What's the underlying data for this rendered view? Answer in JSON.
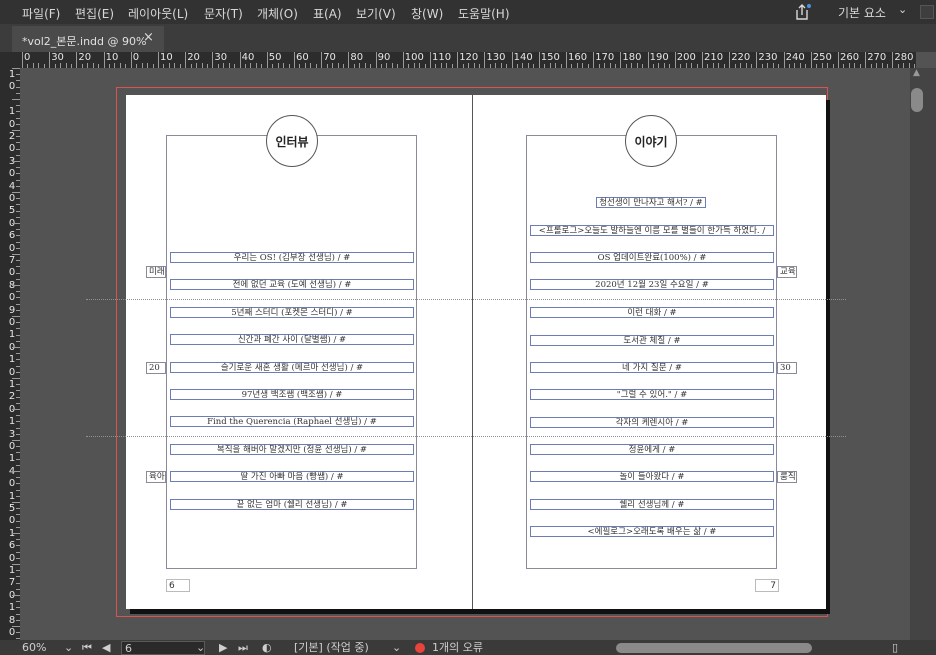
{
  "menubar": {
    "items": [
      "파일(F)",
      "편집(E)",
      "레이아웃(L)",
      "문자(T)",
      "개체(O)",
      "표(A)",
      "보기(V)",
      "창(W)",
      "도움말(H)"
    ],
    "workspace": "기본 요소",
    "workspace_caret": "⌄",
    "share_icon": "share-icon"
  },
  "tab": {
    "label": "*vol2_본문.indd @ 90%",
    "close": "×"
  },
  "ruler": {
    "h_labels": [
      "0",
      "30",
      "20",
      "10",
      "0",
      "10",
      "20",
      "30",
      "40",
      "50",
      "60",
      "70",
      "80",
      "90",
      "100",
      "110",
      "120",
      "130",
      "140",
      "150",
      "160",
      "170",
      "180",
      "190",
      "200",
      "210",
      "220",
      "230",
      "240",
      "250",
      "260",
      "270",
      "280"
    ],
    "v_labels": [
      "1",
      "0",
      "",
      "1",
      "0",
      "2",
      "0",
      "3",
      "0",
      "4",
      "0",
      "5",
      "0",
      "6",
      "0",
      "7",
      "0",
      "8",
      "0",
      "9",
      "0",
      "1",
      "0",
      "1",
      "0",
      "1",
      "2",
      "0",
      "1",
      "3",
      "0",
      "1",
      "4",
      "0",
      "1",
      "5",
      "0",
      "1",
      "6",
      "0",
      "1",
      "7",
      "0",
      "1",
      "8",
      "0"
    ]
  },
  "left_page": {
    "heading": "인터뷰",
    "items": [
      "우리는 OS! (김부장 선생님) / #",
      "전에 없던 교육 (도예 선생님) / #",
      "5년째 스터디 (포켓몬 스터디) / #",
      "신간과 폐간 사이 (달별쌤) / #",
      "슬기로운 새혼 생활 (메르마 선생님) / #",
      "97년생 백조쌤 (백조쌤) / #",
      "Find the Querencia (Raphael 선생님) / #",
      "복직을 해버아 말겠지만 (정윤 선생님) / #",
      "딸 가진 아빠 마음 (빵쌤) / #",
      "끝 없는 엄마 (쉘리 선생님) / #"
    ],
    "side_tags": [
      "미래",
      "20",
      "육아"
    ],
    "folio": "6"
  },
  "right_page": {
    "heading": "이야기",
    "items": [
      "청선생이 만나자고 해서? / #",
      "<프롤로그>오늘도 발하늘엔 이름 모를 별들이 한가득 하였다. /",
      "OS 업데이트완료(100%) / #",
      "2020년 12월 23일 수요일 / #",
      "이런 대화 / #",
      "도서관 체질 / #",
      "네 가지 질문 / #",
      "\"그럴 수 있어.\" / #",
      "각자의 케렌시아 / #",
      "정윤에게 / #",
      "놀이 들아왔다 / #",
      "쉘리 선생님께 / #",
      "<에필로그>오래도록 배우는 삶 / #"
    ],
    "side_tags": [
      "교육",
      "30",
      "룸직"
    ],
    "folio": "7"
  },
  "statusbar": {
    "zoom": "60%",
    "page_number": "6",
    "master": "[기본] (작업 중)",
    "errors": "1개의 오류"
  },
  "colors": {
    "frame_blue": "#6b7db3",
    "bleed_red": "#d9534f",
    "error_red": "#e8443a"
  }
}
